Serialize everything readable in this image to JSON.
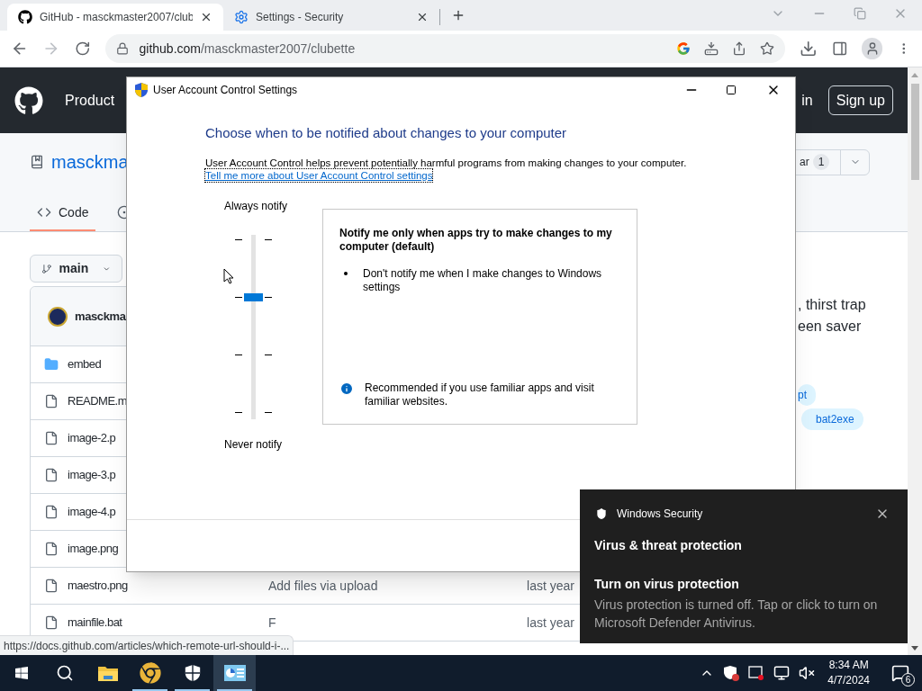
{
  "browser": {
    "tabs": [
      {
        "title": "GitHub - masckmaster2007/club",
        "selected": true,
        "kind": "github"
      },
      {
        "title": "Settings - Security",
        "selected": false,
        "kind": "settings"
      }
    ],
    "address": {
      "host": "github.com",
      "path": "/masckmaster2007/clubette"
    },
    "status_url": "https://docs.github.com/articles/which-remote-url-should-i-..."
  },
  "github": {
    "nav": "Product",
    "sign_in": "in",
    "sign_up": "Sign up",
    "repo": "masckma",
    "star_label": "ar",
    "star_count": "1",
    "tab": "Code",
    "branch": "main",
    "commit_author": "masckma",
    "files": [
      {
        "kind": "folder",
        "name": "embed"
      },
      {
        "kind": "file",
        "name": "README.m"
      },
      {
        "kind": "file",
        "name": "image-2.p"
      },
      {
        "kind": "file",
        "name": "image-3.p"
      },
      {
        "kind": "file",
        "name": "image-4.p"
      },
      {
        "kind": "file",
        "name": "image.png"
      },
      {
        "kind": "file",
        "name": "maestro.png",
        "message": "Add files via upload",
        "time": "last year"
      },
      {
        "kind": "file",
        "name": "mainfile.bat",
        "message": "F",
        "time": "last year"
      }
    ],
    "about": [
      ", thirst trap",
      "een saver"
    ],
    "topics": [
      "pt",
      "bat2exe"
    ]
  },
  "dialog": {
    "title": "User Account Control Settings",
    "heading": "Choose when to be notified about changes to your computer",
    "description": "User Account Control helps prevent potentially harmful programs from making changes to your computer.",
    "link": "Tell me more about User Account Control settings",
    "top_label": "Always notify",
    "bottom_label": "Never notify",
    "level": 0.667,
    "panel": {
      "title": "Notify me only when apps try to make changes to my computer (default)",
      "bullets": [
        "Don't notify me when I make changes to Windows settings"
      ],
      "note": "Recommended if you use familiar apps and visit familiar websites."
    }
  },
  "toast": {
    "app": "Windows Security",
    "title": "Virus & threat protection",
    "subtitle": "Turn on virus protection",
    "body": "Virus protection is turned off. Tap or click to turn on Microsoft Defender Antivirus."
  },
  "taskbar": {
    "apps": [
      {
        "kind": "explorer",
        "running": false,
        "selected": false
      },
      {
        "kind": "chrome",
        "running": true,
        "selected": false
      },
      {
        "kind": "shield",
        "running": true,
        "selected": false
      },
      {
        "kind": "uac",
        "running": true,
        "selected": true
      }
    ],
    "time": "8:34 AM",
    "date": "4/7/2024",
    "notifications": "6"
  }
}
